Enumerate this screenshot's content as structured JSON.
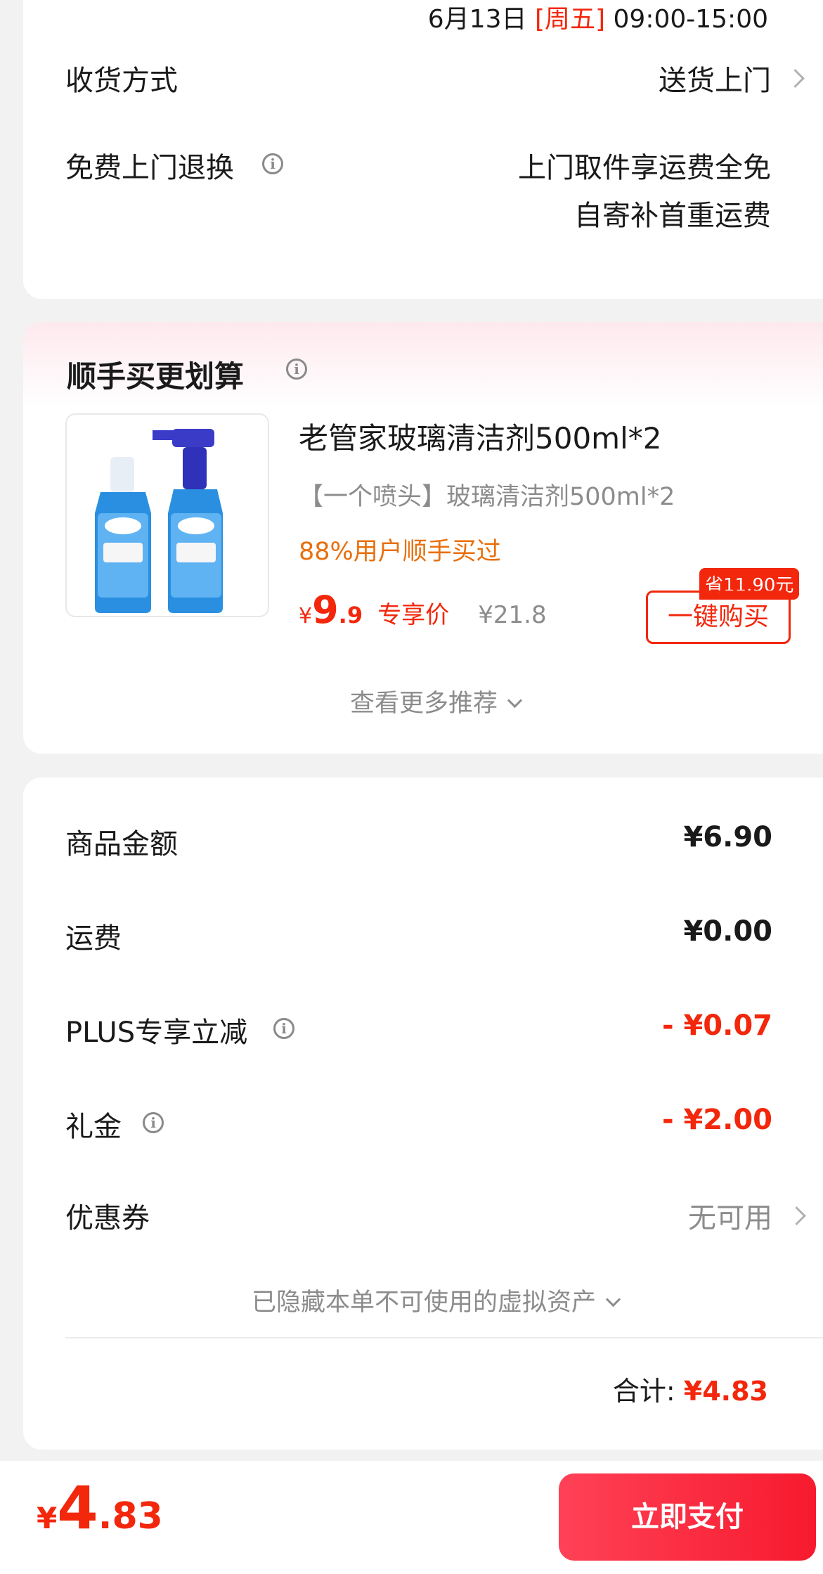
{
  "delivery": {
    "time_date": "6月13日",
    "time_weekday": "[周五]",
    "time_range": "09:00-15:00",
    "method_label": "收货方式",
    "method_value": "送货上门",
    "return_label": "免费上门退换",
    "return_line1": "上门取件享运费全免",
    "return_line2": "自寄补首重运费"
  },
  "upsell": {
    "title": "顺手买更划算",
    "product_name": "老管家玻璃清洁剂500ml*2",
    "product_spec": "【一个喷头】玻璃清洁剂500ml*2",
    "product_stat": "88%用户顺手买过",
    "price_symbol": "¥",
    "price_int": "9",
    "price_dec": ".9",
    "price_tag": "专享价",
    "orig_price": "¥21.8",
    "save_badge": "省11.90元",
    "buy_button": "一键购买",
    "more_label": "查看更多推荐"
  },
  "summary": {
    "rows": [
      {
        "label": "商品金额",
        "value": "¥6.90",
        "style": "normal"
      },
      {
        "label": "运费",
        "value": "¥0.00",
        "style": "normal"
      },
      {
        "label": "PLUS专享立减",
        "value": "- ¥0.07",
        "style": "discount"
      },
      {
        "label": "礼金",
        "value": "- ¥2.00",
        "style": "discount"
      },
      {
        "label": "优惠券",
        "value": "无可用",
        "style": "muted"
      }
    ],
    "hidden_assets": "已隐藏本单不可使用的虚拟资产",
    "total_label": "合计:",
    "total_value": "¥4.83"
  },
  "footer": {
    "price_symbol": "¥",
    "price_int": "4",
    "price_dec": ".83",
    "pay_button": "立即支付"
  },
  "colors": {
    "accent": "#f2270c",
    "orange": "#e8700e",
    "pay_gradient_start": "#ff4157",
    "pay_gradient_end": "#f71a2e"
  }
}
